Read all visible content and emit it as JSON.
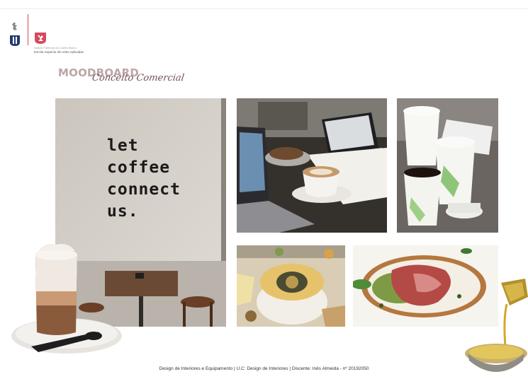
{
  "institution": {
    "line1": "Instituto Politécnico do Castelo Branco",
    "line2": "Escola Superior de Artes Aplicadas"
  },
  "title": {
    "main": "MOODBOARD",
    "subtitle": "Conceito Comercial"
  },
  "photos": {
    "wall_sign": [
      "let",
      "coffee",
      "connect",
      "us."
    ]
  },
  "footer": "Design de Interiores e Equipamento | U.C: Design de Interiores | Discente: Inês Almeida - nº 20192050",
  "colors": {
    "accent": "#d64a5e",
    "title_main": "#bca6a6",
    "title_sub": "#6f4f52"
  }
}
